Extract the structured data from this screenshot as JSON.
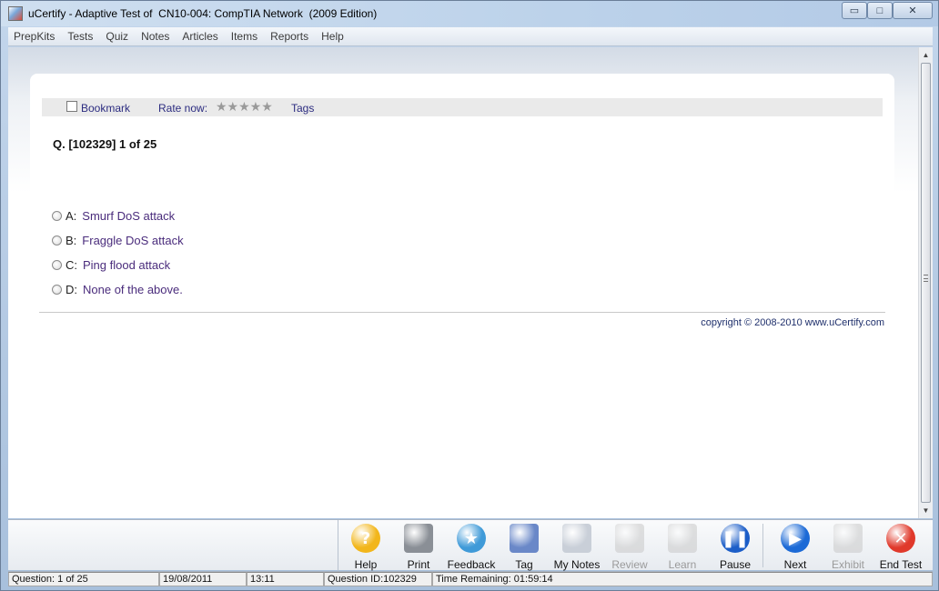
{
  "window": {
    "title": "uCertify - Adaptive Test of  CN10-004: CompTIA Network  (2009 Edition)",
    "controls": {
      "minimize": "▭",
      "maximize": "□",
      "close": "✕"
    }
  },
  "menu": [
    "PrepKits",
    "Tests",
    "Quiz",
    "Notes",
    "Articles",
    "Items",
    "Reports",
    "Help"
  ],
  "toolbar": {
    "bookmark_label": "Bookmark",
    "rate_label": "Rate now:",
    "stars": "★★★★★",
    "tags_label": "Tags"
  },
  "question": {
    "number_text": "Q. [102329] 1 of 25",
    "options": [
      {
        "letter": "A:",
        "text": "Smurf DoS attack"
      },
      {
        "letter": "B:",
        "text": "Fraggle DoS attack"
      },
      {
        "letter": "C:",
        "text": "Ping flood attack"
      },
      {
        "letter": "D:",
        "text": "None of the above."
      }
    ]
  },
  "copyright": "copyright © 2008-2010 www.uCertify.com",
  "buttons": [
    {
      "label": "Help",
      "icon": "help-icon",
      "glyph": "?",
      "color": "#f2b61b",
      "enabled": true
    },
    {
      "label": "Print",
      "icon": "printer-icon",
      "glyph": "",
      "color": "#8a8f96",
      "enabled": true
    },
    {
      "label": "Feedback",
      "icon": "feedback-icon",
      "glyph": "★",
      "color": "#3f9ad8",
      "enabled": true
    },
    {
      "label": "Tag",
      "icon": "tag-icon",
      "glyph": "",
      "color": "#6a88c8",
      "enabled": true
    },
    {
      "label": "My Notes",
      "icon": "notes-icon",
      "glyph": "",
      "color": "#c9cfd8",
      "enabled": true
    },
    {
      "label": "Review",
      "icon": "magnifier-icon",
      "glyph": "",
      "color": "#c8c8c8",
      "enabled": false
    },
    {
      "label": "Learn",
      "icon": "learn-icon",
      "glyph": "",
      "color": "#c8c8c8",
      "enabled": false
    },
    {
      "label": "Pause",
      "icon": "pause-icon",
      "glyph": "❚❚",
      "color": "#1c5ec8",
      "enabled": true
    },
    {
      "label": "Next",
      "icon": "next-icon",
      "glyph": "▶",
      "color": "#1c6ad6",
      "enabled": true
    },
    {
      "label": "Exhibit",
      "icon": "exhibit-icon",
      "glyph": "",
      "color": "#c8c8c8",
      "enabled": false
    },
    {
      "label": "End Test",
      "icon": "end-test-icon",
      "glyph": "✕",
      "color": "#e0392b",
      "enabled": true
    }
  ],
  "status": {
    "question": "Question: 1 of 25",
    "date": "19/08/2011",
    "time": "13:11",
    "question_id": "Question ID:102329",
    "time_remaining": "Time Remaining: 01:59:14"
  }
}
